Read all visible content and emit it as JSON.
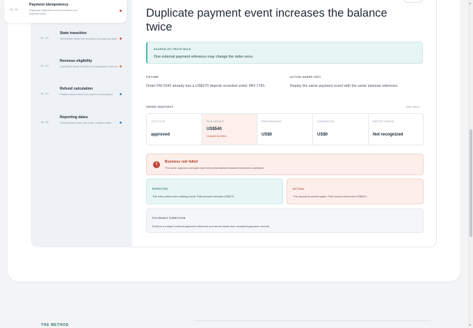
{
  "rules": [
    {
      "code": "BL-01",
      "title": "Payment idempotency",
      "desc": "Duplicate payment event increases the balance twice",
      "dot_color": "#d9483b",
      "active": true
    },
    {
      "code": "BL-02",
      "title": "State transition",
      "desc": "Technician skips the required in-progress state",
      "dot_color": "#d9483b",
      "active": false
    },
    {
      "code": "BL-03",
      "title": "Revenue eligibility",
      "desc": "Cancelled order remains in completed revenue",
      "dot_color": "#e07a2c",
      "active": false
    },
    {
      "code": "BL-04",
      "title": "Refund calculation",
      "desc": "Partial refund does not reduce commission",
      "dot_color": "#3b82c4",
      "active": false
    },
    {
      "code": "BL-05",
      "title": "Reporting dates",
      "desc": "Performance uses the order creation date",
      "dot_color": "#3b82c4",
      "active": false
    }
  ],
  "heading": "Duplicate payment event increases the balance twice",
  "source_of_truth": {
    "label": "SOURCE-OF-TRUTH RULE",
    "text": "One external payment reference may change the order once."
  },
  "fixture": {
    "label": "FIXTURE",
    "text": "Order FM-1042 already has a US$270 deposit recorded under PAY-7781."
  },
  "action": {
    "label": "ACTION UNDER TEST",
    "text": "Replay the same payment event with the same external reference."
  },
  "snapshot": {
    "label": "ORDER SNAPSHOT",
    "after_label": "After defect",
    "cells": [
      {
        "label": "LIFECYCLE",
        "value": "approved",
        "note": ""
      },
      {
        "label": "PAID AMOUNT",
        "value": "US$540",
        "note": "Changed by defect"
      },
      {
        "label": "PERFORMANCE",
        "value": "US$0",
        "note": ""
      },
      {
        "label": "COMMISSION",
        "value": "US$0",
        "note": ""
      },
      {
        "label": "REPORT PERIOD",
        "value": "Not recognized",
        "note": ""
      }
    ]
  },
  "failure": {
    "icon": "!",
    "title": "Business rule failed",
    "text": "The order appears overpaid and every downstream balance becomes unreliable."
  },
  "expected": {
    "label": "EXPECTED",
    "text": "The retry returns the existing result. Paid amount remains US$270."
  },
  "actual": {
    "label": "ACTUAL",
    "text": "The deposit is added again. Paid amount becomes US$540."
  },
  "fix": {
    "label": "FIX-READY DIRECTION",
    "text": "Enforce a unique external payment reference and derive totals from accepted payment records."
  },
  "footer": {
    "section_label": "THE METHOD"
  }
}
